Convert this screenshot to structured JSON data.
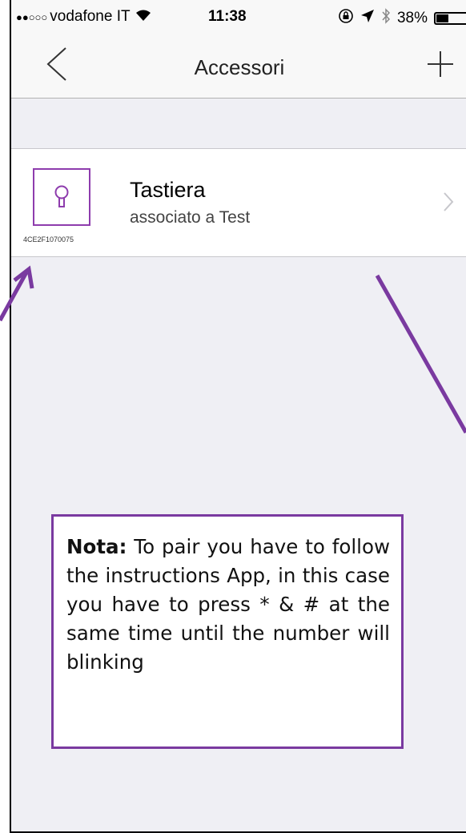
{
  "status_bar": {
    "signal": "●●○○○",
    "carrier": "vodafone IT",
    "wifi_icon": "wifi-icon",
    "time": "11:38",
    "battery_percent": "38%",
    "battery_level": 0.38
  },
  "nav": {
    "title": "Accessori",
    "back_icon": "chevron-left-icon",
    "add_icon": "plus-icon"
  },
  "accessory": {
    "name": "Tastiera",
    "subtitle": "associato a Test",
    "serial": "4CE2F1070075",
    "icon": "keyhole-icon"
  },
  "note": {
    "label": "Nota:",
    "text": " To pair you have to follow the instructions App, in this case you have to press * & # at the same time until the number will blinking"
  },
  "colors": {
    "accent": "#8e3cad",
    "annotation": "#7a3aa0",
    "background": "#efeff4"
  }
}
